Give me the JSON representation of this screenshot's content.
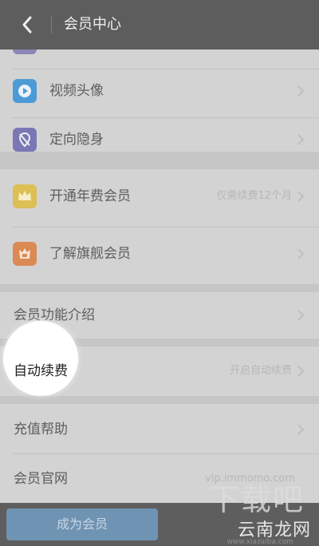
{
  "header": {
    "title": "会员中心"
  },
  "menu_group1": [
    {
      "label": "视频头像",
      "icon": "video-play-icon",
      "color": "#3b8fc9"
    },
    {
      "label": "定向隐身",
      "icon": "location-hidden-icon",
      "color": "#6a66a8"
    }
  ],
  "menu_group2": [
    {
      "label": "开通年费会员",
      "side": "仅需续费12个月",
      "icon": "crown-icon",
      "color": "#d8b43a"
    },
    {
      "label": "了解旗舰会员",
      "icon": "flagship-crown-icon",
      "color": "#d57a3c"
    }
  ],
  "menu_group3": [
    {
      "label": "会员功能介绍"
    }
  ],
  "menu_group4": [
    {
      "label": "自动续费",
      "side": "开启自动续费"
    }
  ],
  "menu_group5": [
    {
      "label": "充值帮助"
    },
    {
      "label": "会员官网",
      "side": "vip.immomo.com"
    }
  ],
  "bottom": {
    "cta_label": "成为会员"
  },
  "watermark": {
    "text": "云南龙网",
    "url": "www.xiazaiba.com",
    "big": "下载吧"
  }
}
